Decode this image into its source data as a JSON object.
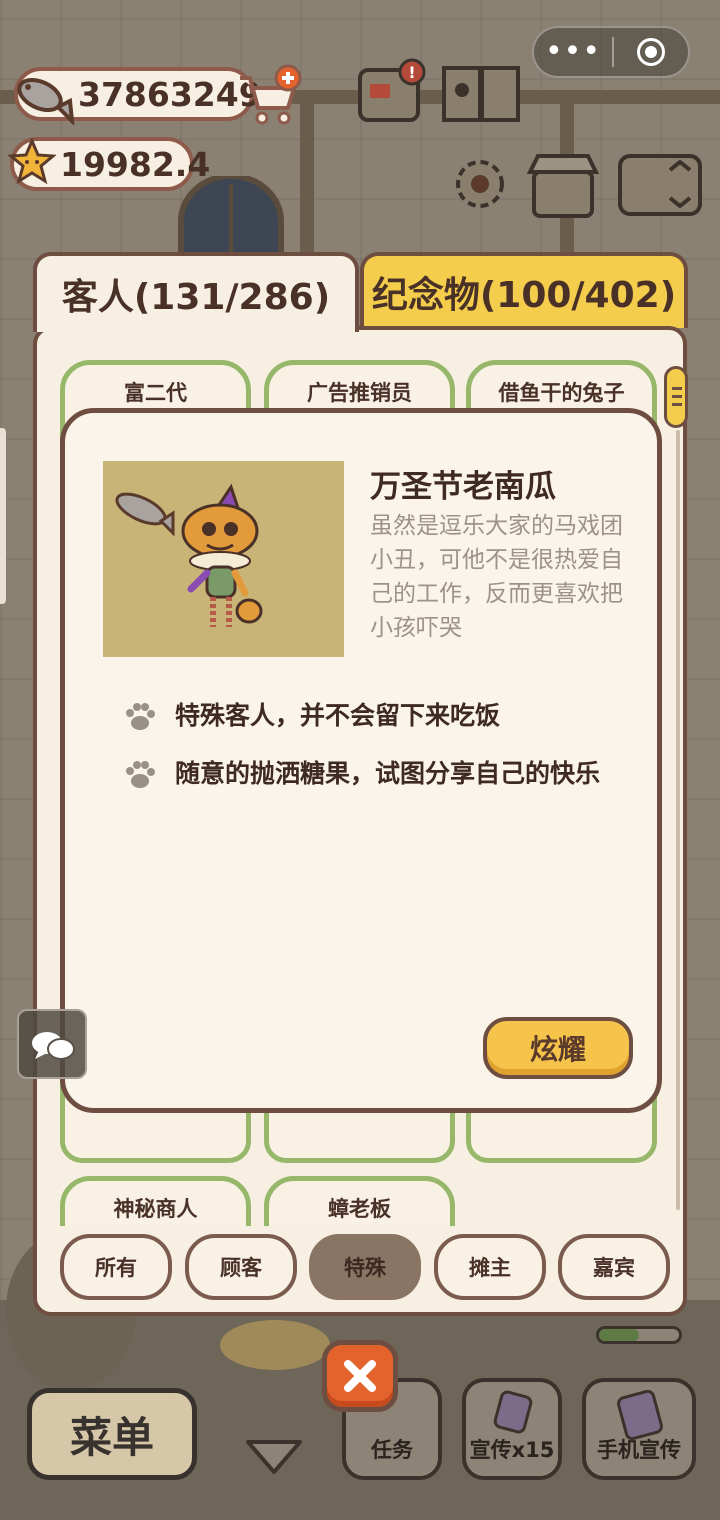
{
  "status": {
    "fish_count": "37863249",
    "star_count": "19982.4"
  },
  "capsule": {
    "more": "•••"
  },
  "tabs": [
    {
      "label": "客人(131/286)",
      "active": true
    },
    {
      "label": "纪念物(100/402)",
      "active": false
    }
  ],
  "cards": [
    {
      "name": "富二代"
    },
    {
      "name": "广告推销员"
    },
    {
      "name": "借鱼干的兔子"
    },
    {
      "name": "神秘商人"
    },
    {
      "name": "蟑老板"
    }
  ],
  "detail": {
    "title": "万圣节老南瓜",
    "description": "虽然是逗乐大家的马戏团小丑，可他不是很热爱自己的工作，反而更喜欢把小孩吓哭",
    "traits": [
      "特殊客人，并不会留下来吃饭",
      "随意的抛洒糖果，试图分享自己的快乐"
    ],
    "show_button": "炫耀"
  },
  "filters": [
    {
      "label": "所有",
      "active": false
    },
    {
      "label": "顾客",
      "active": false
    },
    {
      "label": "特殊",
      "active": true
    },
    {
      "label": "摊主",
      "active": false
    },
    {
      "label": "嘉宾",
      "active": false
    }
  ],
  "bottom_bar": {
    "menu": "菜单",
    "task": "任务",
    "promote": "宣传x15",
    "phone_promote": "手机宣传",
    "progress": 0.5
  },
  "colors": {
    "panel_border": "#6e4e40",
    "card_border": "#97b86a",
    "accent_yellow": "#f7c44b",
    "close_orange": "#e4632d"
  }
}
